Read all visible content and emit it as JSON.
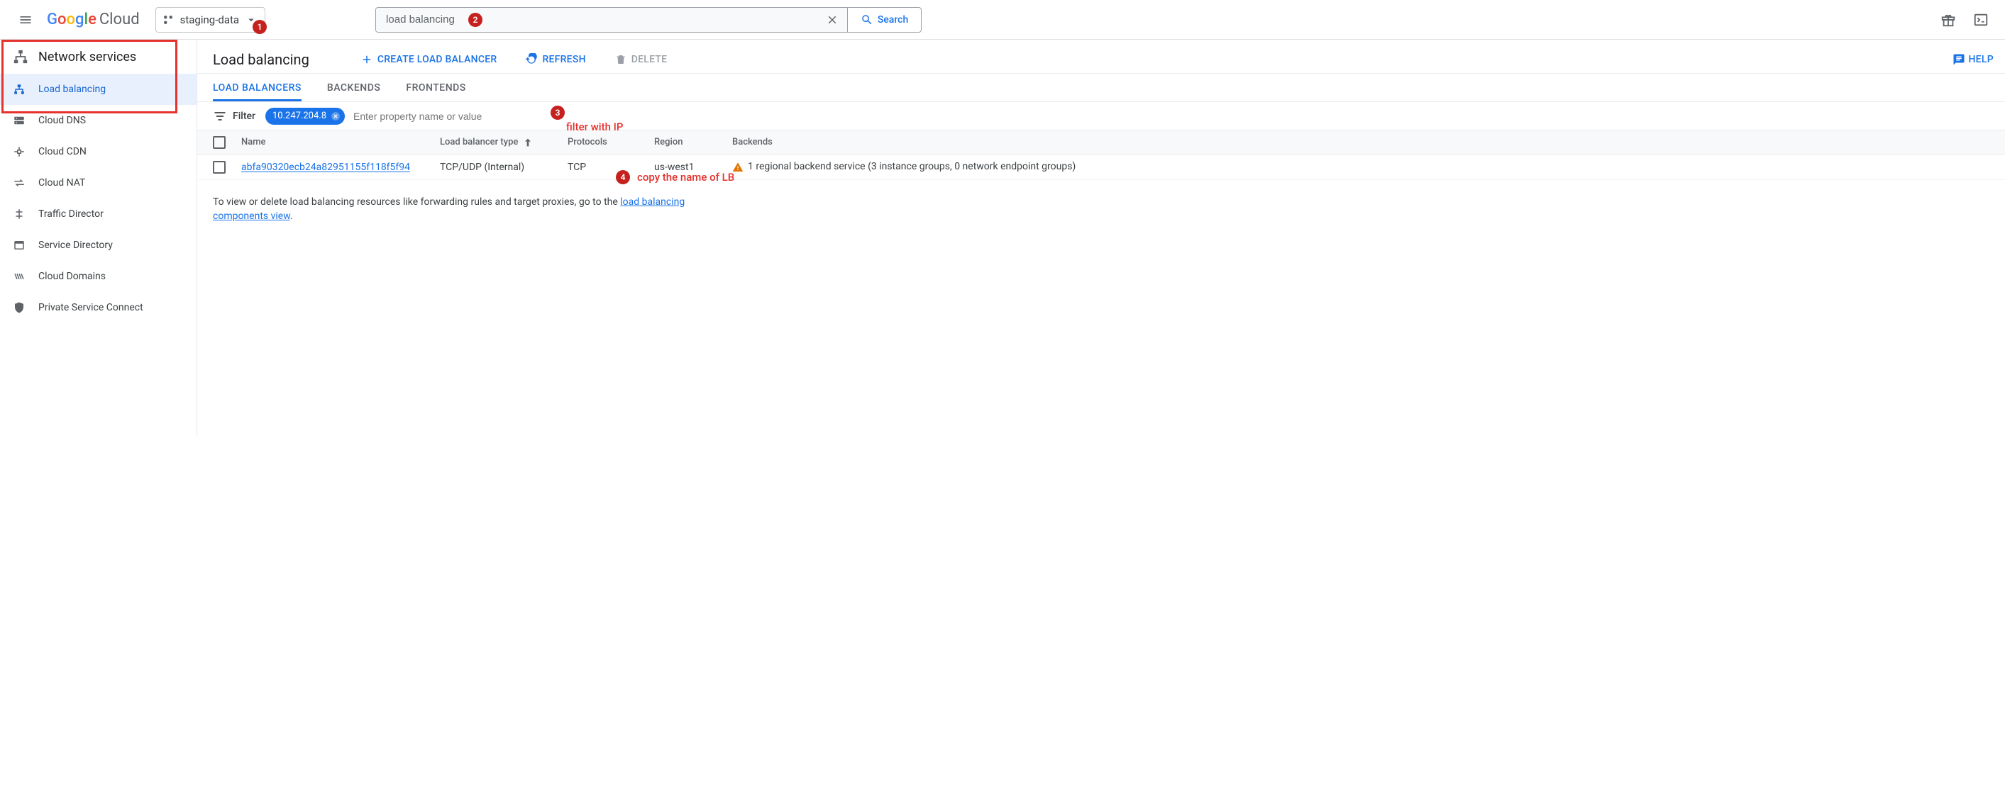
{
  "header": {
    "logo_cloud": "Cloud",
    "project": "staging-data",
    "search_value": "load balancing",
    "search_label": "Search"
  },
  "sidebar": {
    "section": "Network services",
    "items": [
      {
        "label": "Load balancing"
      },
      {
        "label": "Cloud DNS"
      },
      {
        "label": "Cloud CDN"
      },
      {
        "label": "Cloud NAT"
      },
      {
        "label": "Traffic Director"
      },
      {
        "label": "Service Directory"
      },
      {
        "label": "Cloud Domains"
      },
      {
        "label": "Private Service Connect"
      }
    ]
  },
  "page": {
    "title": "Load balancing",
    "actions": {
      "create": "CREATE LOAD BALANCER",
      "refresh": "REFRESH",
      "delete": "DELETE",
      "help": "HELP"
    },
    "tabs": [
      {
        "label": "LOAD BALANCERS"
      },
      {
        "label": "BACKENDS"
      },
      {
        "label": "FRONTENDS"
      }
    ],
    "filter": {
      "label": "Filter",
      "chip_value": "10.247.204.8",
      "placeholder": "Enter property name or value"
    },
    "columns": {
      "name": "Name",
      "type": "Load balancer type",
      "protocols": "Protocols",
      "region": "Region",
      "backends": "Backends"
    },
    "row": {
      "name": "abfa90320ecb24a82951155f118f5f94",
      "type": "TCP/UDP (Internal)",
      "protocols": "TCP",
      "region": "us-west1",
      "backends": "1 regional backend service (3 instance groups, 0 network endpoint groups)"
    },
    "footer": {
      "text1": "To view or delete load balancing resources like forwarding rules and target proxies, go to the ",
      "link": "load balancing components view",
      "text2": "."
    }
  },
  "annotations": {
    "n1": "1",
    "n2": "2",
    "n3": "3",
    "n4": "4",
    "filter_note": "filter with IP",
    "copy_note": "copy the name of LB"
  }
}
